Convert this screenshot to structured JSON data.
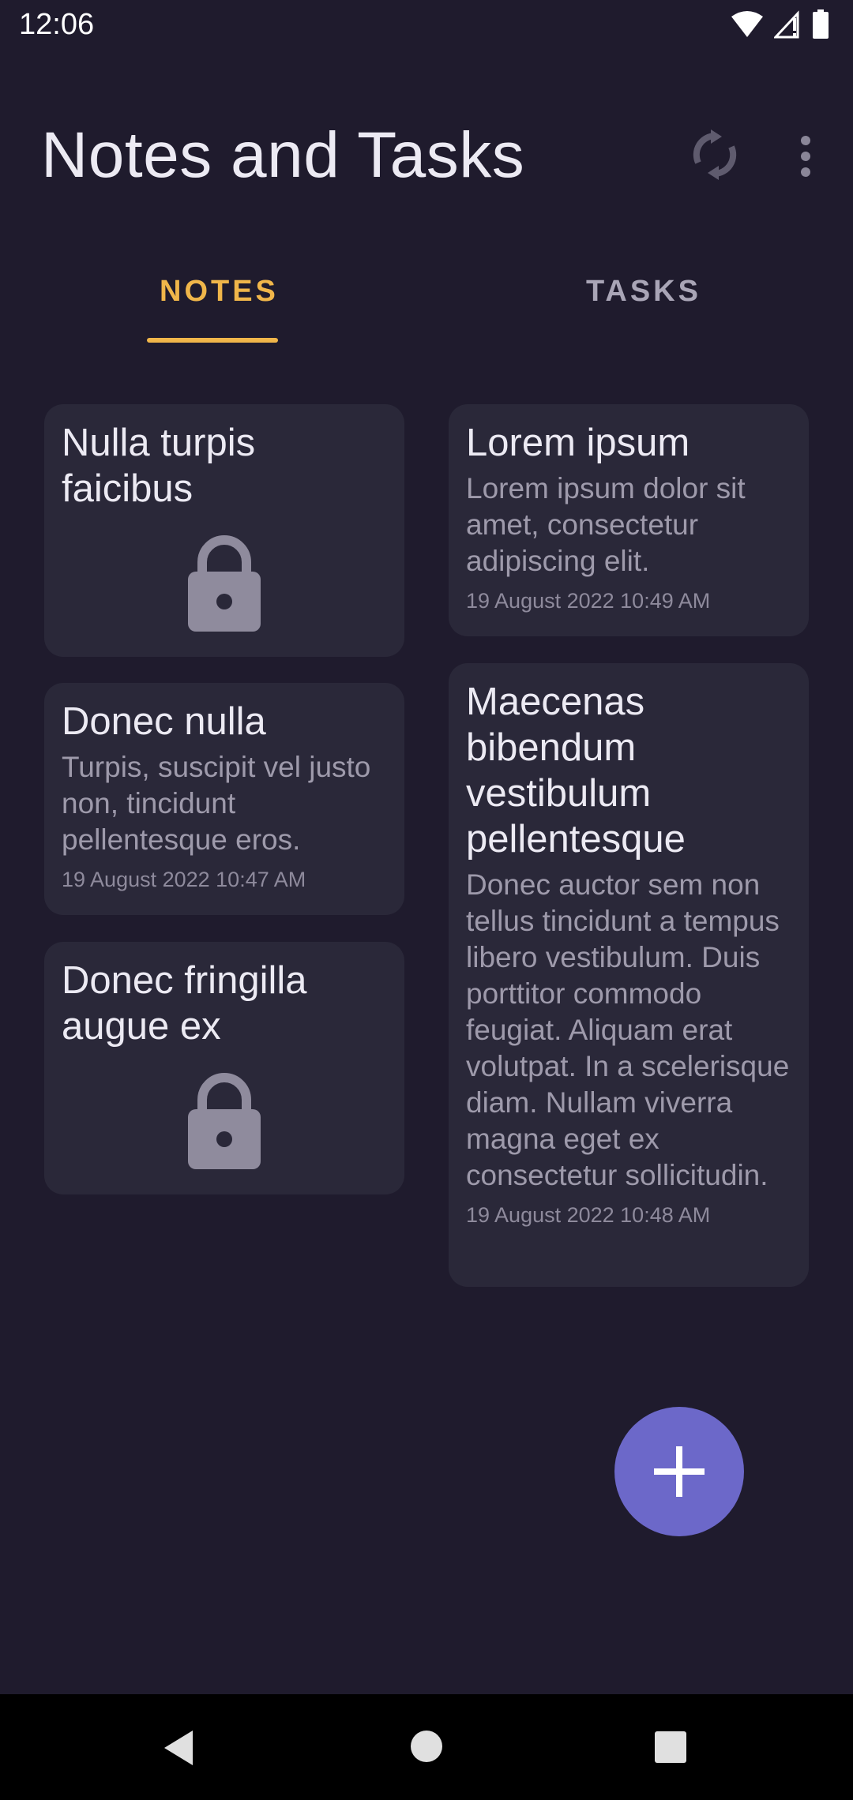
{
  "status_bar": {
    "time": "12:06",
    "icons": [
      "wifi-icon",
      "cellular-icon",
      "battery-icon"
    ]
  },
  "app_bar": {
    "title": "Notes and Tasks",
    "actions": [
      "sync-icon",
      "more-vert-icon"
    ]
  },
  "tabs": [
    {
      "label": "NOTES",
      "selected": true
    },
    {
      "label": "TASKS",
      "selected": false
    }
  ],
  "colors": {
    "background": "#1f1b2d",
    "card": "#2a2839",
    "accent": "#f0b64a",
    "fab": "#6c68c9"
  },
  "notes": [
    {
      "title": "Nulla turpis faicibus",
      "locked": true
    },
    {
      "title": "Lorem ipsum",
      "body": "Lorem ipsum dolor sit amet, consectetur adipiscing elit.",
      "date": "19 August 2022 10:49 AM"
    },
    {
      "title": "Donec nulla",
      "body": "Turpis, suscipit vel justo non, tincidunt pellentesque eros.",
      "date": "19 August 2022 10:47 AM"
    },
    {
      "title": "Maecenas bibendum vestibulum pellentesque",
      "body": "Donec auctor sem non tellus tincidunt a tempus libero vestibulum. Duis porttitor commodo feugiat. Aliquam erat volutpat. In a scelerisque diam. Nullam viverra magna eget ex consectetur sollicitudin.",
      "date": "19 August 2022 10:48 AM"
    },
    {
      "title": "Donec fringilla augue ex",
      "locked": true
    }
  ],
  "fab": {
    "icon": "add-icon"
  },
  "navigation_bar": {
    "buttons": [
      "back-icon",
      "home-icon",
      "recents-icon"
    ]
  }
}
